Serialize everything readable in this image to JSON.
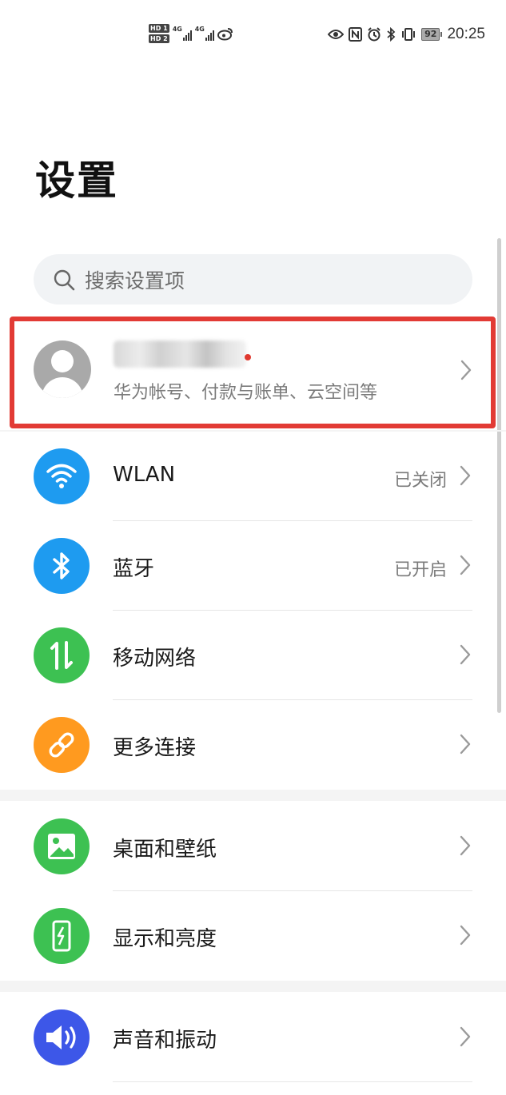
{
  "status_bar": {
    "hd1": "HD 1",
    "hd2": "HD 2",
    "net1": "4G",
    "net2": "4G",
    "battery": "92",
    "time": "20:25"
  },
  "page": {
    "title": "设置"
  },
  "search": {
    "placeholder": "搜索设置项"
  },
  "account": {
    "subtitle": "华为帐号、付款与账单、云空间等"
  },
  "groups": [
    {
      "items": [
        {
          "label": "WLAN",
          "value": "已关闭",
          "icon": "wifi-icon",
          "color": "#1e9bf0"
        },
        {
          "label": "蓝牙",
          "value": "已开启",
          "icon": "bluetooth-icon",
          "color": "#1e9bf0"
        },
        {
          "label": "移动网络",
          "value": "",
          "icon": "mobile-data-icon",
          "color": "#3dc152"
        },
        {
          "label": "更多连接",
          "value": "",
          "icon": "link-icon",
          "color": "#ff9a1f"
        }
      ]
    },
    {
      "items": [
        {
          "label": "桌面和壁纸",
          "value": "",
          "icon": "wallpaper-icon",
          "color": "#3dc152"
        },
        {
          "label": "显示和亮度",
          "value": "",
          "icon": "display-brightness-icon",
          "color": "#3dc152"
        }
      ]
    },
    {
      "items": [
        {
          "label": "声音和振动",
          "value": "",
          "icon": "sound-icon",
          "color": "#3d57e8"
        }
      ]
    }
  ],
  "colors": {
    "highlight_border": "#e23b35",
    "search_bg": "#f1f3f5",
    "group_separator": "#f4f4f4"
  }
}
